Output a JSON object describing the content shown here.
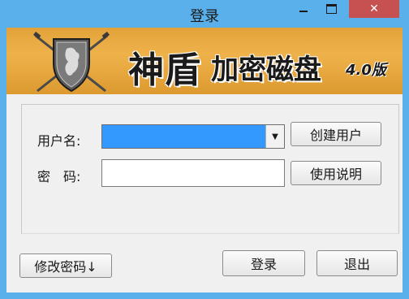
{
  "window": {
    "title": "登录"
  },
  "banner": {
    "title": "神盾",
    "subtitle": "加密磁盘",
    "version": "4.0版",
    "logo_icon": "shield-with-swords-icon"
  },
  "form": {
    "username_label": "用户名:",
    "username_value": "",
    "password_label": "密　码:",
    "password_value": ""
  },
  "buttons": {
    "create_user": "创建用户",
    "help": "使用说明",
    "change_password": "修改密码↓",
    "login": "登录",
    "exit": "退出"
  },
  "colors": {
    "titlebar": "#5ab0ea",
    "close_button": "#c75050",
    "banner": "#e2a23a",
    "combo_selection": "#3399ff"
  }
}
